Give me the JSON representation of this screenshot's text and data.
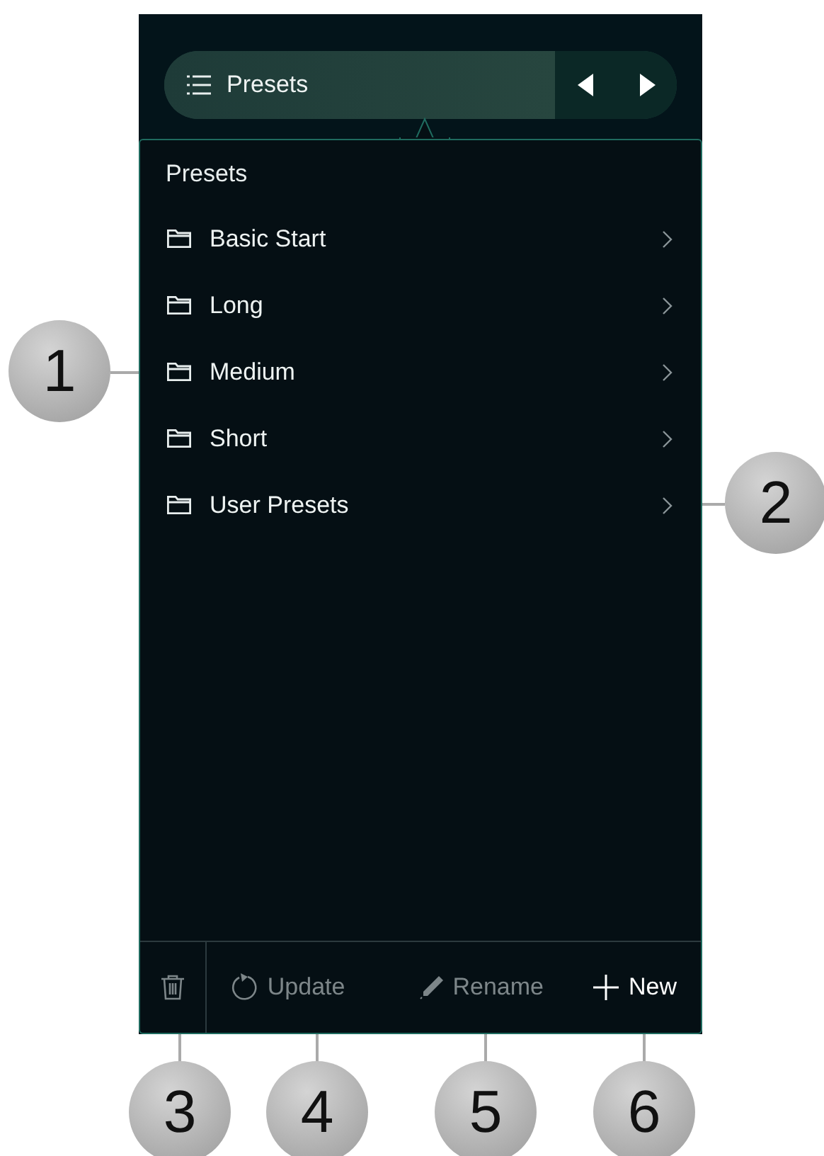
{
  "header": {
    "title": "Presets"
  },
  "list": {
    "title": "Presets",
    "items": [
      {
        "label": "Basic Start"
      },
      {
        "label": "Long"
      },
      {
        "label": "Medium"
      },
      {
        "label": "Short"
      },
      {
        "label": "User Presets"
      }
    ]
  },
  "footer": [
    {
      "kind": "delete",
      "disabled": true
    },
    {
      "kind": "update",
      "label": "Update",
      "disabled": true
    },
    {
      "kind": "rename",
      "label": "Rename",
      "disabled": true
    },
    {
      "kind": "new",
      "label": "New",
      "disabled": false
    }
  ],
  "callouts": [
    {
      "label": "1"
    },
    {
      "label": "2"
    },
    {
      "label": "3"
    },
    {
      "label": "4"
    },
    {
      "label": "5"
    },
    {
      "label": "6"
    }
  ]
}
